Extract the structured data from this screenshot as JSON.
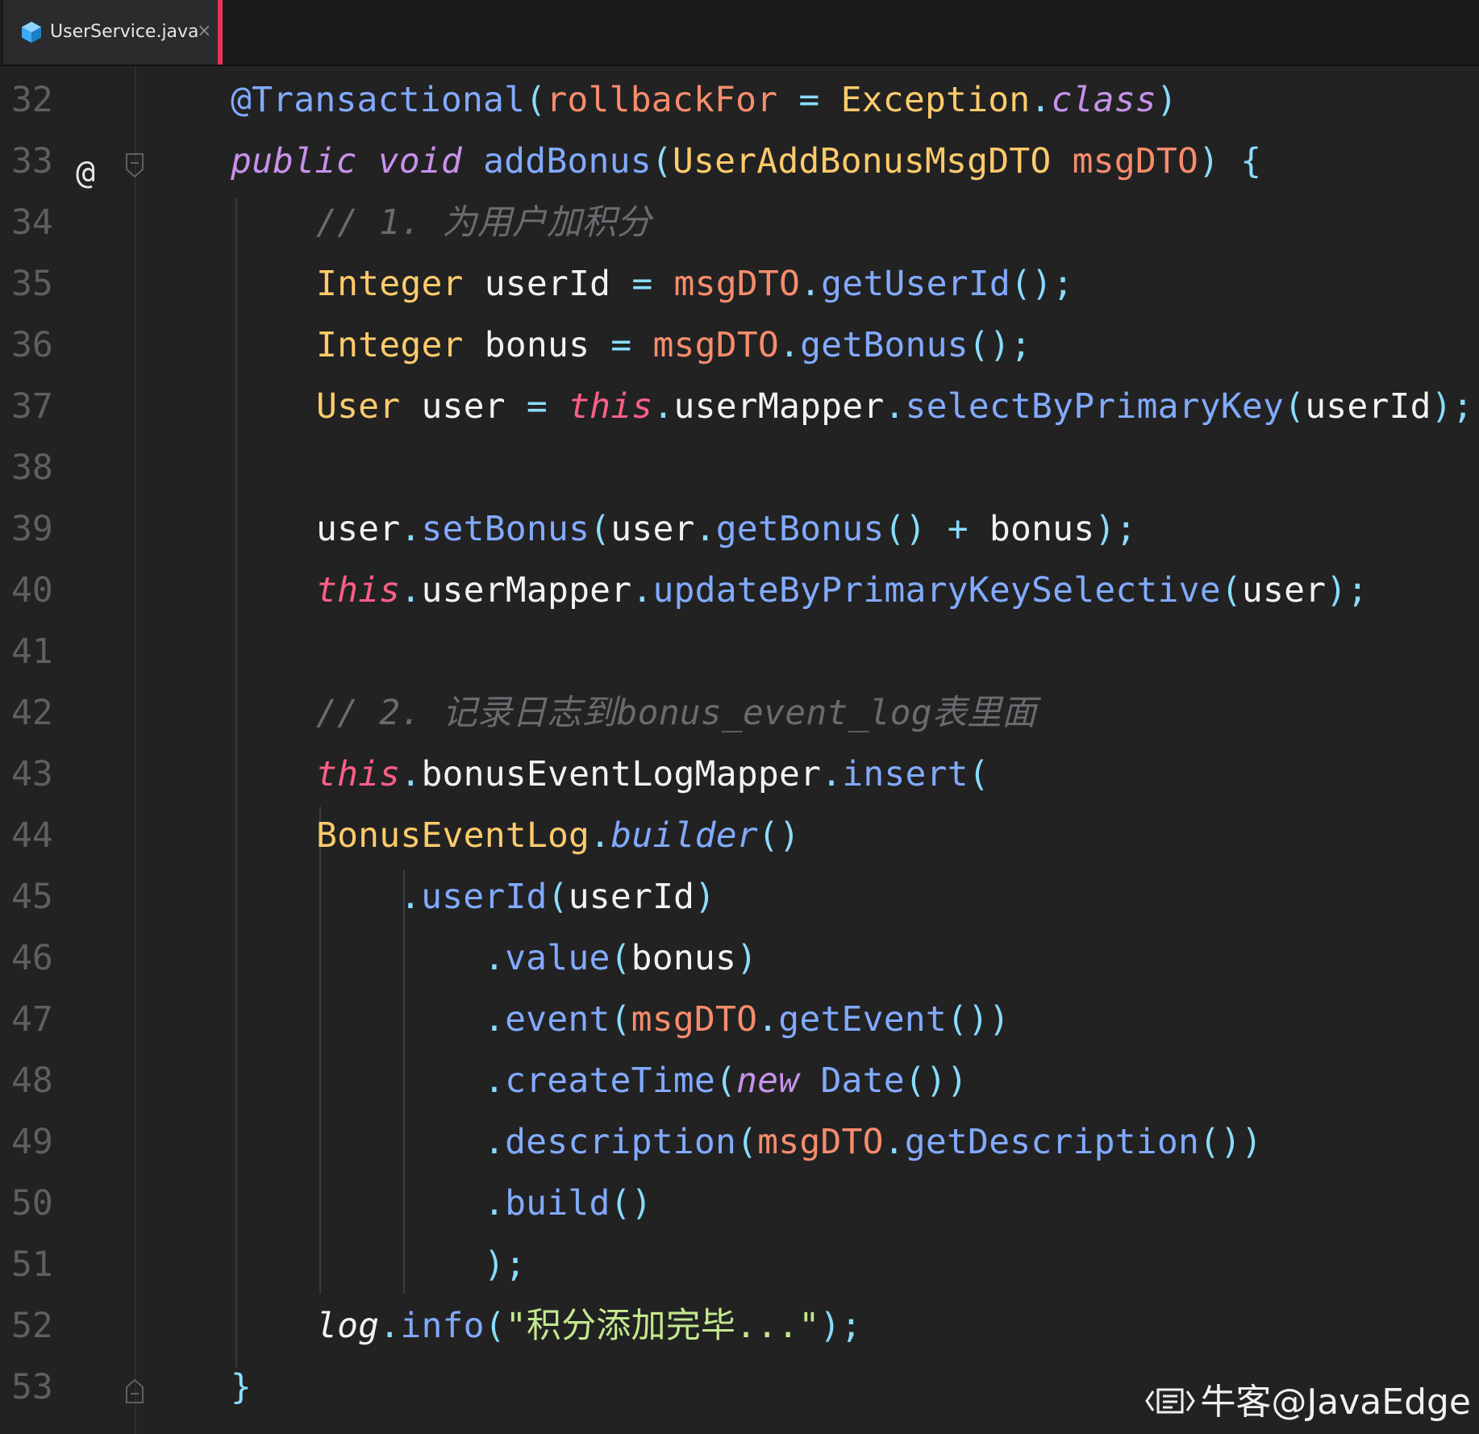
{
  "tab": {
    "filename": "UserService.java",
    "close_glyph": "×",
    "icon": "java-class-icon",
    "accent_color": "#e8335a"
  },
  "gutter": {
    "override_marker": "@"
  },
  "lines": [
    {
      "num": "32",
      "tokens": [
        {
          "t": "@Transactional",
          "c": "fn"
        },
        {
          "t": "(",
          "c": "punc"
        },
        {
          "t": "rollbackFor",
          "c": "var"
        },
        {
          "t": " = ",
          "c": "eq"
        },
        {
          "t": "Exception",
          "c": "type"
        },
        {
          "t": ".",
          "c": "punc"
        },
        {
          "t": "class",
          "c": "kw"
        },
        {
          "t": ")",
          "c": "punc"
        }
      ]
    },
    {
      "num": "33",
      "tokens": [
        {
          "t": "public",
          "c": "kw"
        },
        {
          "t": " ",
          "c": "plain"
        },
        {
          "t": "void",
          "c": "kw"
        },
        {
          "t": " ",
          "c": "plain"
        },
        {
          "t": "addBonus",
          "c": "fn"
        },
        {
          "t": "(",
          "c": "punc"
        },
        {
          "t": "UserAddBonusMsgDTO",
          "c": "type"
        },
        {
          "t": " ",
          "c": "plain"
        },
        {
          "t": "msgDTO",
          "c": "var"
        },
        {
          "t": ")",
          "c": "punc"
        },
        {
          "t": " {",
          "c": "punc"
        }
      ]
    },
    {
      "num": "34",
      "tokens": [
        {
          "t": "// 1. 为用户加积分",
          "c": "com"
        }
      ]
    },
    {
      "num": "35",
      "tokens": [
        {
          "t": "Integer",
          "c": "type"
        },
        {
          "t": " userId ",
          "c": "plain"
        },
        {
          "t": "=",
          "c": "eq"
        },
        {
          "t": " ",
          "c": "plain"
        },
        {
          "t": "msgDTO",
          "c": "var"
        },
        {
          "t": ".",
          "c": "punc"
        },
        {
          "t": "getUserId",
          "c": "fn"
        },
        {
          "t": "();",
          "c": "punc"
        }
      ]
    },
    {
      "num": "36",
      "tokens": [
        {
          "t": "Integer",
          "c": "type"
        },
        {
          "t": " bonus ",
          "c": "plain"
        },
        {
          "t": "=",
          "c": "eq"
        },
        {
          "t": " ",
          "c": "plain"
        },
        {
          "t": "msgDTO",
          "c": "var"
        },
        {
          "t": ".",
          "c": "punc"
        },
        {
          "t": "getBonus",
          "c": "fn"
        },
        {
          "t": "();",
          "c": "punc"
        }
      ]
    },
    {
      "num": "37",
      "tokens": [
        {
          "t": "User",
          "c": "type"
        },
        {
          "t": " user ",
          "c": "plain"
        },
        {
          "t": "=",
          "c": "eq"
        },
        {
          "t": " ",
          "c": "plain"
        },
        {
          "t": "this",
          "c": "this"
        },
        {
          "t": ".",
          "c": "punc"
        },
        {
          "t": "userMapper",
          "c": "plain"
        },
        {
          "t": ".",
          "c": "punc"
        },
        {
          "t": "selectByPrimaryKey",
          "c": "fn"
        },
        {
          "t": "(",
          "c": "punc"
        },
        {
          "t": "userId",
          "c": "plain"
        },
        {
          "t": ");",
          "c": "punc"
        }
      ]
    },
    {
      "num": "38",
      "tokens": []
    },
    {
      "num": "39",
      "tokens": [
        {
          "t": "user",
          "c": "plain"
        },
        {
          "t": ".",
          "c": "punc"
        },
        {
          "t": "setBonus",
          "c": "fn"
        },
        {
          "t": "(",
          "c": "punc"
        },
        {
          "t": "user",
          "c": "plain"
        },
        {
          "t": ".",
          "c": "punc"
        },
        {
          "t": "getBonus",
          "c": "fn"
        },
        {
          "t": "()",
          "c": "punc"
        },
        {
          "t": " + ",
          "c": "eq"
        },
        {
          "t": "bonus",
          "c": "plain"
        },
        {
          "t": ");",
          "c": "punc"
        }
      ]
    },
    {
      "num": "40",
      "tokens": [
        {
          "t": "this",
          "c": "this"
        },
        {
          "t": ".",
          "c": "punc"
        },
        {
          "t": "userMapper",
          "c": "plain"
        },
        {
          "t": ".",
          "c": "punc"
        },
        {
          "t": "updateByPrimaryKeySelective",
          "c": "fn"
        },
        {
          "t": "(",
          "c": "punc"
        },
        {
          "t": "user",
          "c": "plain"
        },
        {
          "t": ");",
          "c": "punc"
        }
      ]
    },
    {
      "num": "41",
      "tokens": []
    },
    {
      "num": "42",
      "tokens": [
        {
          "t": "// 2. 记录日志到bonus_event_log表里面",
          "c": "com"
        }
      ]
    },
    {
      "num": "43",
      "tokens": [
        {
          "t": "this",
          "c": "this"
        },
        {
          "t": ".",
          "c": "punc"
        },
        {
          "t": "bonusEventLogMapper",
          "c": "plain"
        },
        {
          "t": ".",
          "c": "punc"
        },
        {
          "t": "insert",
          "c": "fn"
        },
        {
          "t": "(",
          "c": "punc"
        }
      ]
    },
    {
      "num": "44",
      "tokens": [
        {
          "t": "BonusEventLog",
          "c": "type"
        },
        {
          "t": ".",
          "c": "punc"
        },
        {
          "t": "builder",
          "c": "fn-it"
        },
        {
          "t": "()",
          "c": "punc"
        }
      ]
    },
    {
      "num": "45",
      "tokens": [
        {
          "t": ".",
          "c": "punc"
        },
        {
          "t": "userId",
          "c": "fn"
        },
        {
          "t": "(",
          "c": "punc"
        },
        {
          "t": "userId",
          "c": "plain"
        },
        {
          "t": ")",
          "c": "punc"
        }
      ]
    },
    {
      "num": "46",
      "tokens": [
        {
          "t": ".",
          "c": "punc"
        },
        {
          "t": "value",
          "c": "fn"
        },
        {
          "t": "(",
          "c": "punc"
        },
        {
          "t": "bonus",
          "c": "plain"
        },
        {
          "t": ")",
          "c": "punc"
        }
      ]
    },
    {
      "num": "47",
      "tokens": [
        {
          "t": ".",
          "c": "punc"
        },
        {
          "t": "event",
          "c": "fn"
        },
        {
          "t": "(",
          "c": "punc"
        },
        {
          "t": "msgDTO",
          "c": "var"
        },
        {
          "t": ".",
          "c": "punc"
        },
        {
          "t": "getEvent",
          "c": "fn"
        },
        {
          "t": "())",
          "c": "punc"
        }
      ]
    },
    {
      "num": "48",
      "tokens": [
        {
          "t": ".",
          "c": "punc"
        },
        {
          "t": "createTime",
          "c": "fn"
        },
        {
          "t": "(",
          "c": "punc"
        },
        {
          "t": "new",
          "c": "kw"
        },
        {
          "t": " ",
          "c": "plain"
        },
        {
          "t": "Date",
          "c": "fn"
        },
        {
          "t": "())",
          "c": "punc"
        }
      ]
    },
    {
      "num": "49",
      "tokens": [
        {
          "t": ".",
          "c": "punc"
        },
        {
          "t": "description",
          "c": "fn"
        },
        {
          "t": "(",
          "c": "punc"
        },
        {
          "t": "msgDTO",
          "c": "var"
        },
        {
          "t": ".",
          "c": "punc"
        },
        {
          "t": "getDescription",
          "c": "fn"
        },
        {
          "t": "())",
          "c": "punc"
        }
      ]
    },
    {
      "num": "50",
      "tokens": [
        {
          "t": ".",
          "c": "punc"
        },
        {
          "t": "build",
          "c": "fn"
        },
        {
          "t": "()",
          "c": "punc"
        }
      ]
    },
    {
      "num": "51",
      "tokens": [
        {
          "t": ");",
          "c": "punc"
        }
      ]
    },
    {
      "num": "52",
      "tokens": [
        {
          "t": "log",
          "c": "plain-it"
        },
        {
          "t": ".",
          "c": "punc"
        },
        {
          "t": "info",
          "c": "fn"
        },
        {
          "t": "(",
          "c": "punc"
        },
        {
          "t": "\"积分添加完毕...\"",
          "c": "str"
        },
        {
          "t": ");",
          "c": "punc"
        }
      ]
    },
    {
      "num": "53",
      "tokens": [
        {
          "t": "}",
          "c": "punc"
        }
      ]
    }
  ],
  "watermark": {
    "text": "牛客@JavaEdge",
    "icon": "nowcoder-logo-icon"
  }
}
